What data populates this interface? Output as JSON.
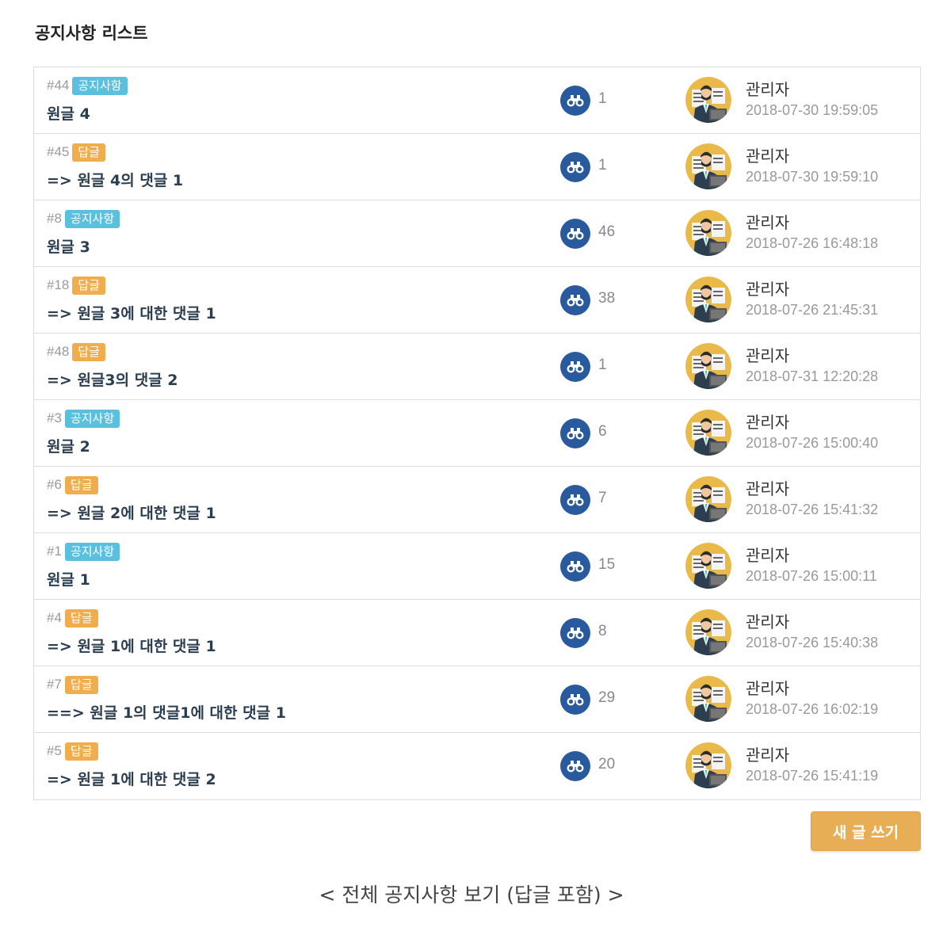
{
  "page": {
    "title": "공지사항 리스트",
    "write_button": "새 글 쓰기",
    "caption": "< 전체 공지사항 보기 (답글 포함) >"
  },
  "colors": {
    "notice_badge": "#5bc0de",
    "reply_badge": "#f0ad4e",
    "view_icon": "#2a5a9e",
    "write_button": "#e8ae55"
  },
  "icons": {
    "views": "binoculars-icon",
    "author": "avatar-icon"
  },
  "posts": [
    {
      "number": "#44",
      "type": "notice",
      "badge": "공지사항",
      "title": "원글 4",
      "views": "1",
      "author": "관리자",
      "date": "2018-07-30 19:59:05"
    },
    {
      "number": "#45",
      "type": "reply",
      "badge": "답글",
      "title": "=> 원글 4의 댓글 1",
      "views": "1",
      "author": "관리자",
      "date": "2018-07-30 19:59:10"
    },
    {
      "number": "#8",
      "type": "notice",
      "badge": "공지사항",
      "title": "원글 3",
      "views": "46",
      "author": "관리자",
      "date": "2018-07-26 16:48:18"
    },
    {
      "number": "#18",
      "type": "reply",
      "badge": "답글",
      "title": "=> 원글 3에 대한 댓글 1",
      "views": "38",
      "author": "관리자",
      "date": "2018-07-26 21:45:31"
    },
    {
      "number": "#48",
      "type": "reply",
      "badge": "답글",
      "title": "=> 원글3의 댓글 2",
      "views": "1",
      "author": "관리자",
      "date": "2018-07-31 12:20:28"
    },
    {
      "number": "#3",
      "type": "notice",
      "badge": "공지사항",
      "title": "원글 2",
      "views": "6",
      "author": "관리자",
      "date": "2018-07-26 15:00:40"
    },
    {
      "number": "#6",
      "type": "reply",
      "badge": "답글",
      "title": "=> 원글 2에 대한 댓글 1",
      "views": "7",
      "author": "관리자",
      "date": "2018-07-26 15:41:32"
    },
    {
      "number": "#1",
      "type": "notice",
      "badge": "공지사항",
      "title": "원글 1",
      "views": "15",
      "author": "관리자",
      "date": "2018-07-26 15:00:11"
    },
    {
      "number": "#4",
      "type": "reply",
      "badge": "답글",
      "title": "=> 원글 1에 대한 댓글 1",
      "views": "8",
      "author": "관리자",
      "date": "2018-07-26 15:40:38"
    },
    {
      "number": "#7",
      "type": "reply",
      "badge": "답글",
      "title": "==> 원글 1의 댓글1에 대한 댓글 1",
      "views": "29",
      "author": "관리자",
      "date": "2018-07-26 16:02:19"
    },
    {
      "number": "#5",
      "type": "reply",
      "badge": "답글",
      "title": "=> 원글 1에 대한 댓글 2",
      "views": "20",
      "author": "관리자",
      "date": "2018-07-26 15:41:19"
    }
  ]
}
